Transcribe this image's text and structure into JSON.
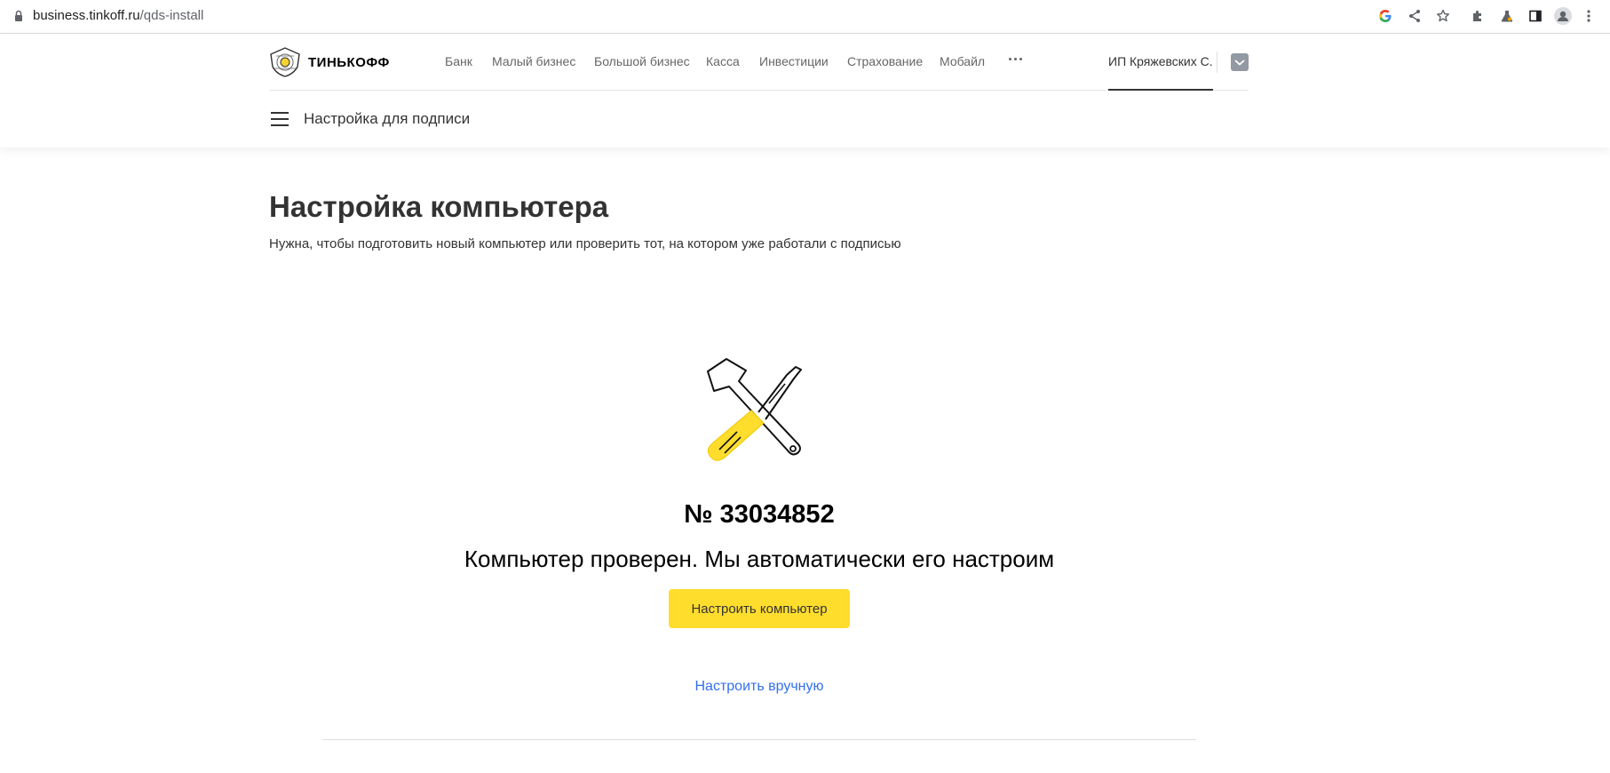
{
  "browser": {
    "url_host": "business.tinkoff.ru",
    "url_path": "/qds-install"
  },
  "header": {
    "logo_text": "ТИНЬКОФФ",
    "nav": [
      {
        "label": "Банк"
      },
      {
        "label": "Малый бизнес"
      },
      {
        "label": "Большой бизнес"
      },
      {
        "label": "Касса"
      },
      {
        "label": "Инвестиции"
      },
      {
        "label": "Страхование"
      },
      {
        "label": "Мобайл"
      }
    ],
    "account_name": "ИП Кряжевских С.",
    "section_title": "Настройка для подписи"
  },
  "main": {
    "title": "Настройка компьютера",
    "subtitle": "Нужна, чтобы подготовить новый компьютер или проверить тот, на котором уже работали с подписью",
    "number": "№ 33034852",
    "status": "Компьютер проверен. Мы автоматически его настроим",
    "primary_button": "Настроить компьютер",
    "manual_link": "Настроить вручную"
  },
  "colors": {
    "accent_yellow": "#ffdd2d",
    "link_blue": "#336fee"
  }
}
